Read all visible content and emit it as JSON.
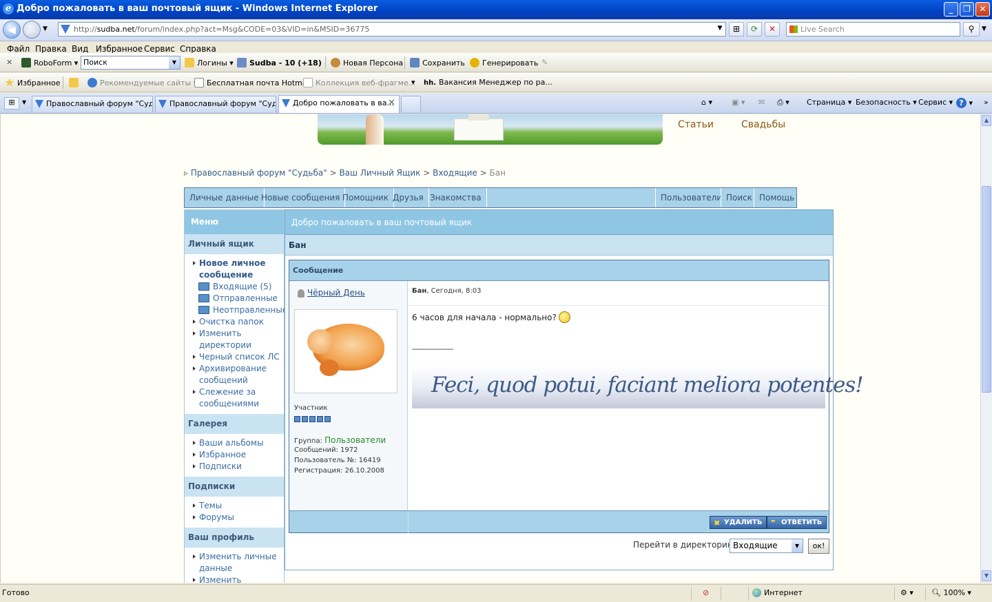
{
  "window": {
    "title": "Добро пожаловать в ваш почтовый ящик - Windows Internet Explorer",
    "controls": [
      "_",
      "❐",
      "✕"
    ]
  },
  "address": {
    "url_prefix": "http://",
    "url_host": "sudba.net",
    "url_path": "/forum/index.php?act=Msg&CODE=03&VID=in&MSID=36775",
    "search_placeholder": "Live Search"
  },
  "menu": [
    "Файл",
    "Правка",
    "Вид",
    "Избранное",
    "Сервис",
    "Справка"
  ],
  "roboform": {
    "close": "✕",
    "brand": "RoboForm",
    "search_value": "Поиск",
    "logins": "Логины",
    "passcard": "Sudba - 10 (+18)",
    "new_persona": "Новая Персона",
    "save": "Сохранить",
    "generate": "Генерировать"
  },
  "favorites_bar": {
    "favorites": "Избранное",
    "items": [
      "Рекомендуемые сайты",
      "Бесплатная почта Hotmail",
      "Коллекция веб-фрагме...",
      "Вакансия Менеджер по ра..."
    ]
  },
  "tabs": [
    {
      "label": "Православный форум \"Суд..."
    },
    {
      "label": "Православный форум \"Суд..."
    },
    {
      "label": "Добро пожаловать в ва..."
    }
  ],
  "commandbar": {
    "page": "Страница",
    "safety": "Безопасность",
    "tools": "Сервис",
    "help": "?"
  },
  "site": {
    "top_links": [
      "Статьи",
      "Свадьбы"
    ],
    "breadcrumb": {
      "forum": "Православный форум \"Судьба\"",
      "mailbox": "Ваш Личный Ящик",
      "inbox": "Входящие",
      "current": "Бан",
      "sep": ">"
    },
    "nav_left": [
      "Личные данные",
      "Новые сообщения",
      "Помощник",
      "Друзья",
      "Знакомства"
    ],
    "nav_right": [
      "Пользователи",
      "Поиск",
      "Помощь"
    ]
  },
  "sidebar": {
    "header": "Меню",
    "personal_box": {
      "title": "Личный ящик",
      "new_message": "Новое личное сообщение",
      "inbox": "Входящие (5)",
      "sent": "Отправленные",
      "unsent": "Неотправленные",
      "items": [
        "Очистка папок",
        "Изменить директории",
        "Черный список ЛС",
        "Архивирование сообщений",
        "Слежение за сообщениями"
      ]
    },
    "gallery": {
      "title": "Галерея",
      "items": [
        "Ваши альбомы",
        "Избранное",
        "Подписки"
      ]
    },
    "subscriptions": {
      "title": "Подписки",
      "items": [
        "Темы",
        "Форумы"
      ]
    },
    "profile": {
      "title": "Ваш профиль",
      "items": [
        "Изменить личные данные",
        "Изменить настройки"
      ]
    }
  },
  "main": {
    "header": "Добро пожаловать в ваш почтовый ящик",
    "subject": "Бан",
    "box_title": "Сообщение",
    "author": "Чёрный День",
    "author_rank": "Участник",
    "rank_pips": 5,
    "group_label": "Группа:",
    "group_value": "Пользователи",
    "posts": "Сообщений: 1972",
    "user_no": "Пользователь №: 16419",
    "registered": "Регистрация: 26.10.2008",
    "msg_title": "Бан",
    "msg_time": ", Сегодня, 8:03",
    "msg_body": "6 часов для начала - нормально?",
    "signature_line": "--------------------",
    "signature": "Feci, quod potui, faciant meliora potentes!",
    "delete_btn": "УДАЛИТЬ",
    "reply_btn": "ОТВЕТИТЬ",
    "jump_label": "Перейти в директорию:",
    "jump_value": "Входящие",
    "ok_btn": "ок!"
  },
  "statusbar": {
    "text": "Готово",
    "zone": "Интернет",
    "zoom": "100%"
  }
}
